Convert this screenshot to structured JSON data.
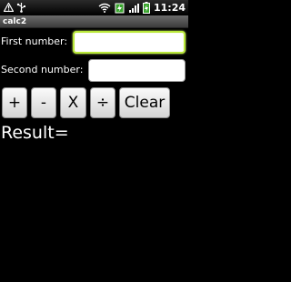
{
  "status_bar": {
    "time": "11:24",
    "icons": [
      "warning-icon",
      "usb-icon",
      "wifi-icon",
      "battery-charging-icon",
      "signal-icon",
      "battery-icon"
    ]
  },
  "app": {
    "title": "calc2"
  },
  "form": {
    "first_label": "First number:",
    "first_value": "",
    "second_label": "Second number:",
    "second_value": ""
  },
  "buttons": {
    "plus": "+",
    "minus": "-",
    "times": "X",
    "divide": "÷",
    "clear": "Clear"
  },
  "result": {
    "label": "Result="
  },
  "colors": {
    "background": "#000000",
    "focus_highlight": "#b9e83a",
    "button_top": "#fafafa",
    "button_bottom": "#d4d4d4"
  }
}
